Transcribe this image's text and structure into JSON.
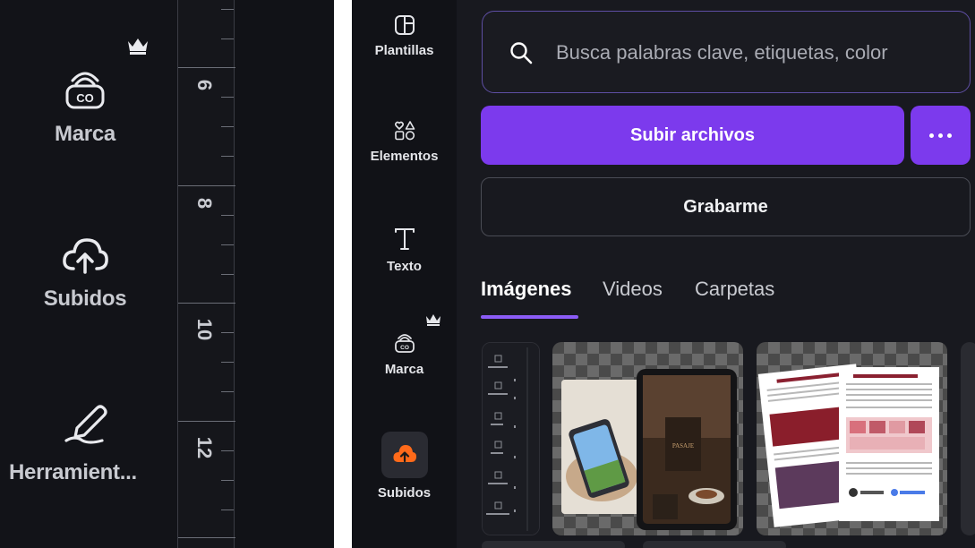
{
  "zoomed_panel": {
    "nav_items": [
      {
        "label": "Marca",
        "icon": "brand-kit-icon",
        "premium": true
      },
      {
        "label": "Subidos",
        "icon": "cloud-upload-icon"
      },
      {
        "label": "Herramient...",
        "icon": "pen-icon"
      }
    ],
    "ruler_labels": [
      "6",
      "8",
      "10",
      "12"
    ]
  },
  "sidebar": {
    "items": [
      {
        "label": "Plantillas",
        "icon": "templates-icon"
      },
      {
        "label": "Elementos",
        "icon": "elements-icon"
      },
      {
        "label": "Texto",
        "icon": "text-icon"
      },
      {
        "label": "Marca",
        "icon": "brand-kit-icon",
        "premium": true
      },
      {
        "label": "Subidos",
        "icon": "cloud-upload-icon",
        "active": true
      }
    ]
  },
  "search": {
    "placeholder": "Busca palabras clave, etiquetas, color"
  },
  "actions": {
    "upload_label": "Subir archivos",
    "record_label": "Grabarme"
  },
  "tabs": [
    {
      "label": "Imágenes",
      "active": true
    },
    {
      "label": "Videos"
    },
    {
      "label": "Carpetas"
    }
  ],
  "colors": {
    "accent": "#7c3aed",
    "active_tab_underline": "#8b5cf6",
    "upload_icon": "#ff6a1a"
  }
}
